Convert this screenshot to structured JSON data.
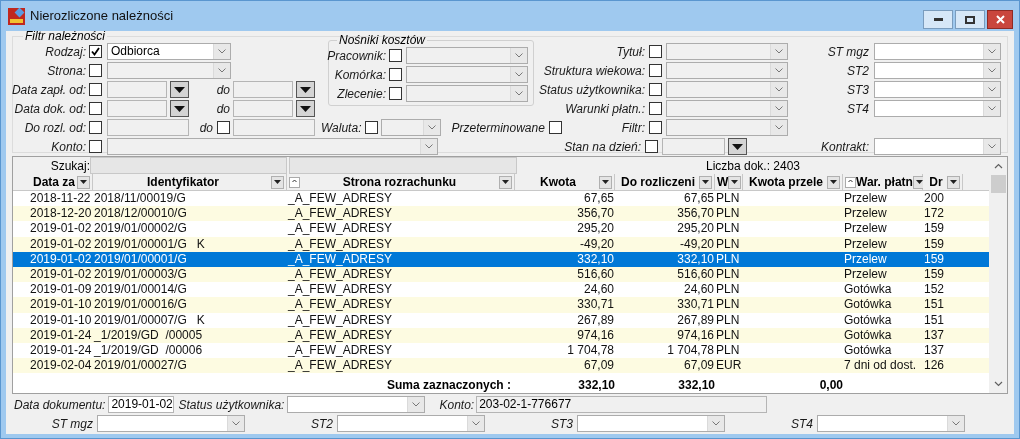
{
  "window": {
    "title": "Nierozliczone należności"
  },
  "filter": {
    "legend": "Filtr należności",
    "rodzaj": {
      "label": "Rodzaj:",
      "checked": true,
      "value": "Odbiorca"
    },
    "strona": {
      "label": "Strona:",
      "checked": false
    },
    "date_ranges": [
      {
        "label": "Data zapł. od:",
        "checked": false,
        "to_label": "do"
      },
      {
        "label": "Data dok. od:",
        "checked": false,
        "to_label": "do"
      }
    ],
    "do_rozl": {
      "label": "Do rozl. od:",
      "checked": false,
      "to_label": "do",
      "to_checked": false
    },
    "waluta": {
      "label": "Waluta:",
      "checked": false
    },
    "przeterminowane": {
      "label": "Przeterminowane",
      "checked": false
    },
    "konto": {
      "label": "Konto:",
      "checked": false
    },
    "cost_carriers": {
      "legend": "Nośniki kosztów",
      "items": [
        {
          "label": "Pracownik:",
          "checked": false
        },
        {
          "label": "Komórka:",
          "checked": false
        },
        {
          "label": "Zlecenie:",
          "checked": false
        }
      ]
    },
    "conditions": [
      {
        "label": "Tytuł:",
        "checked": false,
        "kind": "combo"
      },
      {
        "label": "Struktura wiekowa:",
        "checked": false,
        "kind": "combo"
      },
      {
        "label": "Status użytkownika:",
        "checked": false,
        "kind": "combo"
      },
      {
        "label": "Warunki płatn.:",
        "checked": false,
        "kind": "combo"
      },
      {
        "label": "Filtr:",
        "checked": false,
        "kind": "combo"
      },
      {
        "label": "Stan na dzień:",
        "checked": false,
        "kind": "date"
      }
    ],
    "st_fields": [
      {
        "label": "ST mgz"
      },
      {
        "label": "ST2"
      },
      {
        "label": "ST3"
      },
      {
        "label": "ST4"
      }
    ],
    "kontrakt": {
      "label": "Kontrakt:"
    }
  },
  "grid": {
    "search_label": "Szukaj:",
    "doc_count": "Liczba dok.: 2403",
    "columns": [
      {
        "label": "Data za",
        "sorted": false
      },
      {
        "label": "Identyfikator",
        "sorted": false
      },
      {
        "label": "Strona rozrachunku",
        "sorted": true
      },
      {
        "label": "Kwota",
        "sorted": false
      },
      {
        "label": "Do rozliczeni",
        "sorted": false
      },
      {
        "label": "W",
        "sorted": false
      },
      {
        "label": "Kwota przele",
        "sorted": false
      },
      {
        "label": "War. płatn",
        "sorted": true
      },
      {
        "label": "Dr",
        "sorted": false
      }
    ],
    "rows": [
      {
        "date": "2018-11-22",
        "id": "2018/11/00019/G",
        "party": "_A_FEW_ADRESY",
        "amount": "67,65",
        "to_settle": "67,65",
        "currency": "PLN",
        "terms": "Przelew",
        "days": "200",
        "selected": false
      },
      {
        "date": "2018-12-20",
        "id": "2018/12/00010/G",
        "party": "_A_FEW_ADRESY",
        "amount": "356,70",
        "to_settle": "356,70",
        "currency": "PLN",
        "terms": "Przelew",
        "days": "172",
        "selected": false
      },
      {
        "date": "2019-01-02",
        "id": "2019/01/00002/G",
        "party": "_A_FEW_ADRESY",
        "amount": "295,20",
        "to_settle": "295,20",
        "currency": "PLN",
        "terms": "Przelew",
        "days": "159",
        "selected": false
      },
      {
        "date": "2019-01-02",
        "id": "2019/01/00001/G   K",
        "party": "_A_FEW_ADRESY",
        "amount": "-49,20",
        "to_settle": "-49,20",
        "currency": "PLN",
        "terms": "Przelew",
        "days": "159",
        "selected": false
      },
      {
        "date": "2019-01-02",
        "id": "2019/01/00001/G",
        "party": "_A_FEW_ADRESY",
        "amount": "332,10",
        "to_settle": "332,10",
        "currency": "PLN",
        "terms": "Przelew",
        "days": "159",
        "selected": true
      },
      {
        "date": "2019-01-02",
        "id": "2019/01/00003/G",
        "party": "_A_FEW_ADRESY",
        "amount": "516,60",
        "to_settle": "516,60",
        "currency": "PLN",
        "terms": "Przelew",
        "days": "159",
        "selected": false
      },
      {
        "date": "2019-01-09",
        "id": "2019/01/00014/G",
        "party": "_A_FEW_ADRESY",
        "amount": "24,60",
        "to_settle": "24,60",
        "currency": "PLN",
        "terms": "Gotówka",
        "days": "152",
        "selected": false
      },
      {
        "date": "2019-01-10",
        "id": "2019/01/00016/G",
        "party": "_A_FEW_ADRESY",
        "amount": "330,71",
        "to_settle": "330,71",
        "currency": "PLN",
        "terms": "Gotówka",
        "days": "151",
        "selected": false
      },
      {
        "date": "2019-01-10",
        "id": "2019/01/00007/G   K",
        "party": "_A_FEW_ADRESY",
        "amount": "267,89",
        "to_settle": "267,89",
        "currency": "PLN",
        "terms": "Gotówka",
        "days": "151",
        "selected": false
      },
      {
        "date": "2019-01-24",
        "id": "_1/2019/GD  /00005",
        "party": "_A_FEW_ADRESY",
        "amount": "974,16",
        "to_settle": "974,16",
        "currency": "PLN",
        "terms": "Gotówka",
        "days": "137",
        "selected": false
      },
      {
        "date": "2019-01-24",
        "id": "_1/2019/GD  /00006",
        "party": "_A_FEW_ADRESY",
        "amount": "1 704,78",
        "to_settle": "1 704,78",
        "currency": "PLN",
        "terms": "Gotówka",
        "days": "137",
        "selected": false
      },
      {
        "date": "2019-02-04",
        "id": "2019/01/00027/G",
        "party": "_A_FEW_ADRESY",
        "amount": "67,09",
        "to_settle": "67,09",
        "currency": "EUR",
        "terms": "7 dni od dost.",
        "days": "126",
        "selected": false
      }
    ],
    "totals": {
      "label": "Suma zaznaczonych :",
      "amount": "332,10",
      "to_settle": "332,10",
      "transfer": "0,00"
    }
  },
  "footer": {
    "data_dokumentu": {
      "label": "Data dokumentu:",
      "value": "2019-01-02"
    },
    "status": {
      "label": "Status użytkownika:"
    },
    "konto": {
      "label": "Konto:",
      "value": "203-02-1-776677"
    },
    "st_fields": [
      {
        "label": "ST mgz"
      },
      {
        "label": "ST2"
      },
      {
        "label": "ST3"
      },
      {
        "label": "ST4"
      }
    ]
  }
}
